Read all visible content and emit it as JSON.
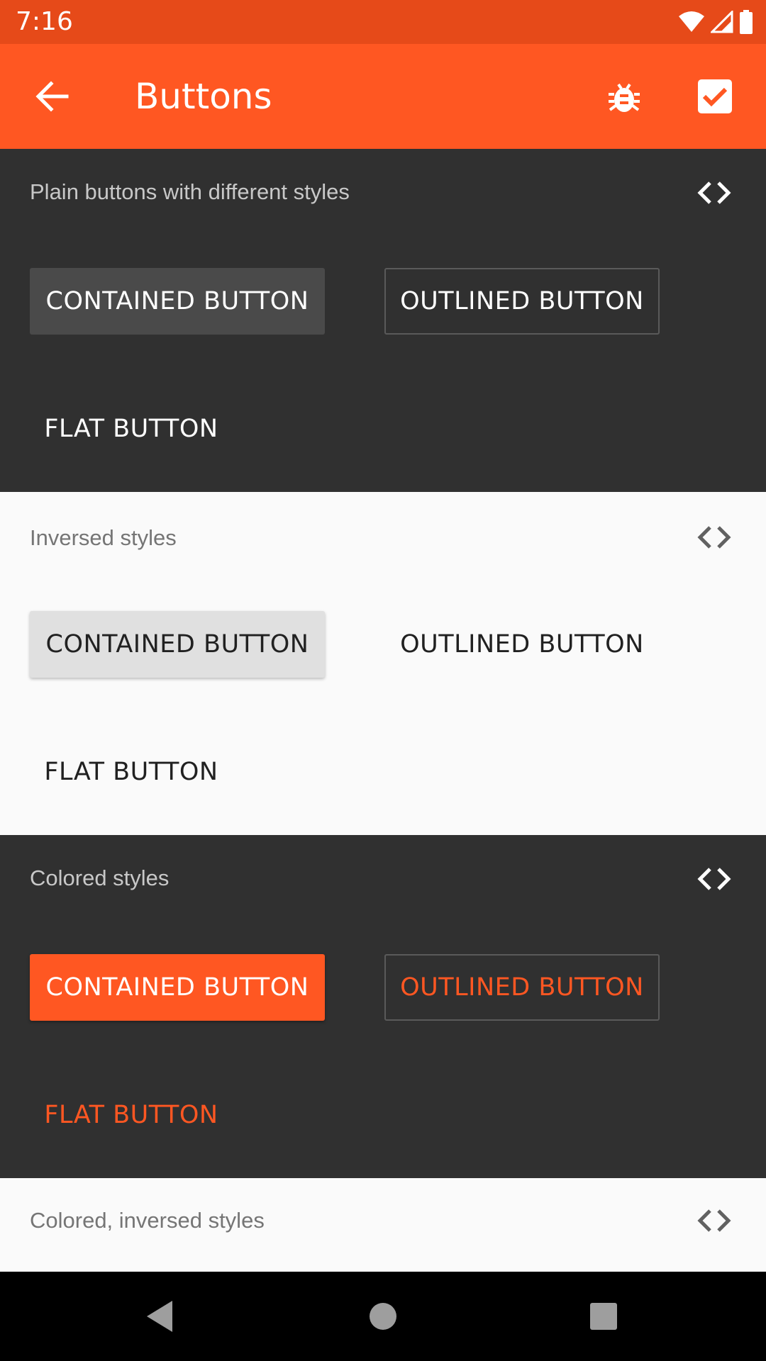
{
  "status_bar": {
    "time": "7:16",
    "icons": [
      "wifi-icon",
      "signal-icon",
      "battery-icon"
    ]
  },
  "app_bar": {
    "title": "Buttons",
    "back_icon": "arrow-back-icon",
    "actions": [
      "bug-icon",
      "checkbox-checked-icon"
    ],
    "color": "#ff5722"
  },
  "sections": [
    {
      "label": "Plain buttons with different styles",
      "theme": "dark",
      "contained_label": "CONTAINED BUTTON",
      "outlined_label": "OUTLINED BUTTON",
      "flat_label": "FLAT BUTTON"
    },
    {
      "label": "Inversed styles",
      "theme": "light",
      "contained_label": "CONTAINED BUTTON",
      "outlined_label": "OUTLINED BUTTON",
      "flat_label": "FLAT BUTTON"
    },
    {
      "label": "Colored styles",
      "theme": "dark",
      "contained_label": "CONTAINED BUTTON",
      "outlined_label": "OUTLINED BUTTON",
      "flat_label": "FLAT BUTTON",
      "accent": "#ff5722"
    },
    {
      "label": "Colored, inversed styles",
      "theme": "light"
    }
  ],
  "nav_bar": {
    "buttons": [
      "back-triangle-icon",
      "home-circle-icon",
      "recents-square-icon"
    ]
  },
  "colors": {
    "status_bar": "#e64a19",
    "dark_bg": "#303030",
    "light_bg": "#fafafa"
  }
}
